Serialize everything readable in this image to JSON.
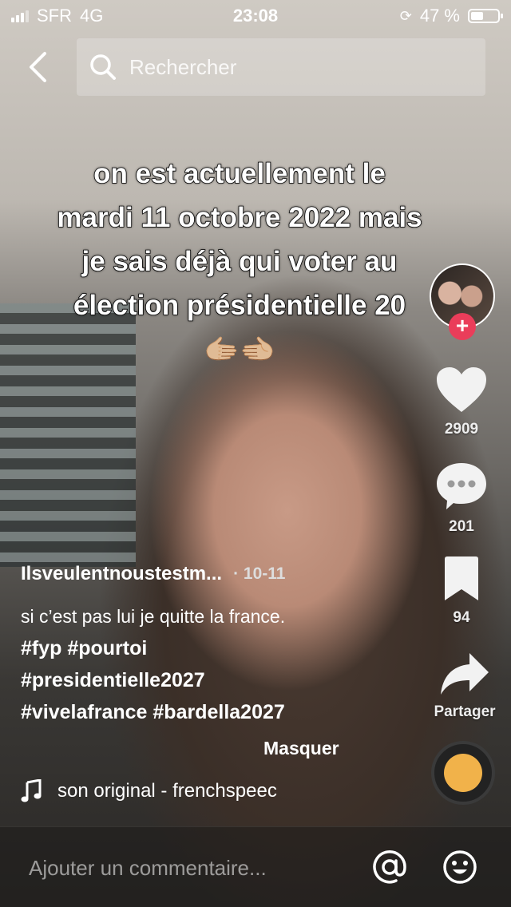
{
  "status_bar": {
    "carrier": "SFR",
    "network": "4G",
    "time": "23:08",
    "battery_pct": "47 %",
    "battery_level": 0.47
  },
  "search": {
    "placeholder": "Rechercher"
  },
  "video": {
    "overlay_lines": [
      "on est actuellement le",
      "mardi 11 octobre 2022 mais",
      "je sais déjà qui voter au",
      "élection présidentielle 20"
    ],
    "overlay_emoji": "🫱🏼🫲🏼"
  },
  "rail": {
    "likes": "2909",
    "comments": "201",
    "saves": "94",
    "share_label": "Partager"
  },
  "post": {
    "username": "Ilsveulentnoustestm...",
    "date": "· 10-11",
    "caption": "si c’est pas lui je quitte la france.",
    "hashtags_1": "#fyp #pourtoi",
    "hashtags_2": "#presidentielle2027",
    "hashtags_3": "#vivelafrance #bardella2027",
    "hide_label": "Masquer",
    "sound": "son original - frenchspeec"
  },
  "comment": {
    "placeholder": "Ajouter un commentaire..."
  },
  "colors": {
    "follow": "#ea3d5a",
    "disc": "#f1b24a"
  }
}
